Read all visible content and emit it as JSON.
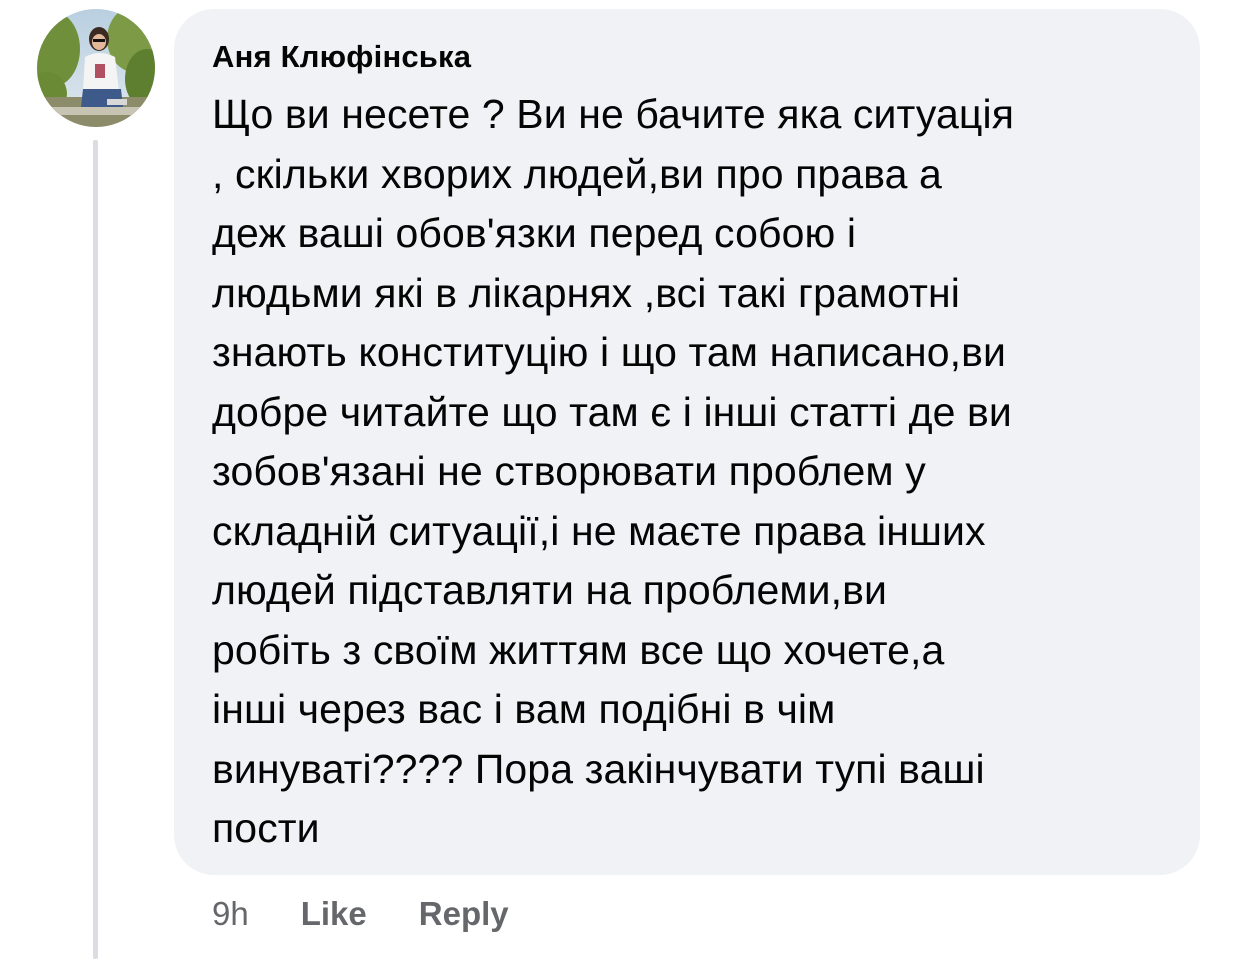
{
  "comment": {
    "author": "Аня Клюфінська",
    "text": "Що ви несете ? Ви не бачите яка ситуація\n, скільки хворих людей,ви про права а\nдеж ваші обов'язки перед собою і\nлюдьми які в лікарнях ,всі такі грамотні\nзнають конституцію і що там написано,ви\nдобре читайте що там є і інші статті де ви\nзобов'язані не створювати проблем у\nскладній ситуації,і не маєте права інших\nлюдей підставляти на проблеми,ви\nробіть з своїм життям все що хочете,а\nінші через вас і вам подібні в чім\nвинуваті???? Пора закінчувати тупі ваші\nпости",
    "timestamp": "9h",
    "like_label": "Like",
    "reply_label": "Reply"
  },
  "colors": {
    "bubble_bg": "#f0f2f5",
    "text": "#050505",
    "meta_text": "#65676b",
    "thread_line": "#dadde1"
  },
  "icons": {
    "avatar": "profile-photo"
  }
}
